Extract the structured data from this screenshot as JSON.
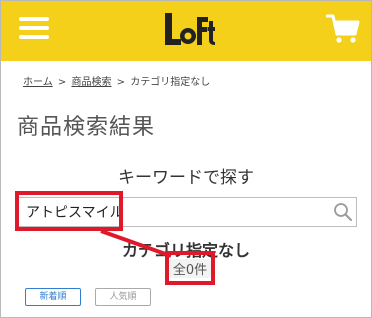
{
  "header": {
    "logo_text": "LoFt",
    "colors": {
      "brand_yellow": "#f5d01a",
      "icon_white": "#ffffff"
    },
    "icons": {
      "menu": "hamburger-menu-icon",
      "cart": "shopping-cart-icon"
    }
  },
  "breadcrumb": {
    "home": "ホーム",
    "sep1": ">",
    "search": "商品検索",
    "sep2": ">",
    "current": "カテゴリ指定なし"
  },
  "page_title": "商品検索結果",
  "search": {
    "heading": "キーワードで探す",
    "value": "アトピスマイル",
    "placeholder": ""
  },
  "category_heading": "カテゴリ指定なし",
  "result_count": "全0件",
  "sort": {
    "new": "新着順",
    "popular": "人気順"
  },
  "annotation_color": "#e0192a"
}
